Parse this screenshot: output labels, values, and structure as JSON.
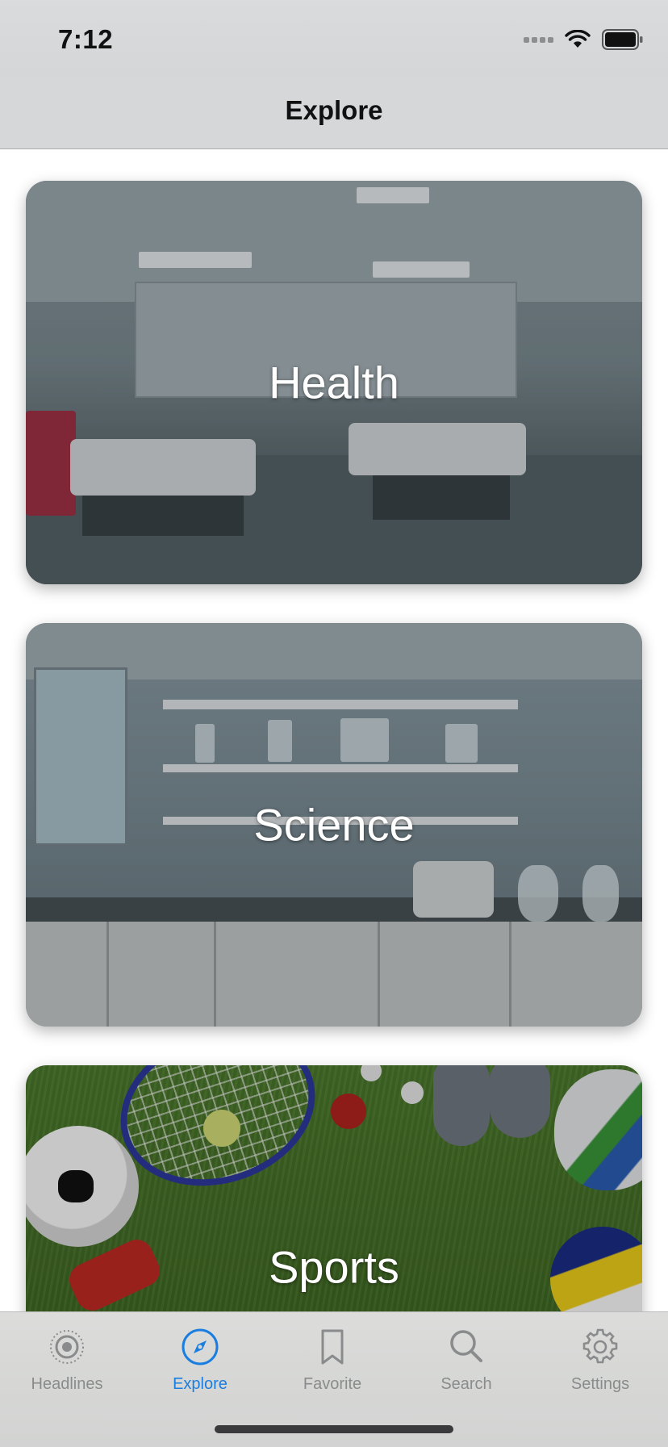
{
  "status_bar": {
    "time": "7:12",
    "icons": [
      "signal-icon",
      "wifi-icon",
      "battery-icon"
    ]
  },
  "nav": {
    "title": "Explore"
  },
  "cards": [
    {
      "label": "Health"
    },
    {
      "label": "Science"
    },
    {
      "label": "Sports"
    }
  ],
  "tab_bar": {
    "active_color": "#1a7de0",
    "inactive_color": "#8a8b8c",
    "items": [
      {
        "label": "Headlines",
        "icon": "headlines-icon",
        "active": false
      },
      {
        "label": "Explore",
        "icon": "compass-icon",
        "active": true
      },
      {
        "label": "Favorite",
        "icon": "bookmark-icon",
        "active": false
      },
      {
        "label": "Search",
        "icon": "search-icon",
        "active": false
      },
      {
        "label": "Settings",
        "icon": "gear-icon",
        "active": false
      }
    ]
  }
}
